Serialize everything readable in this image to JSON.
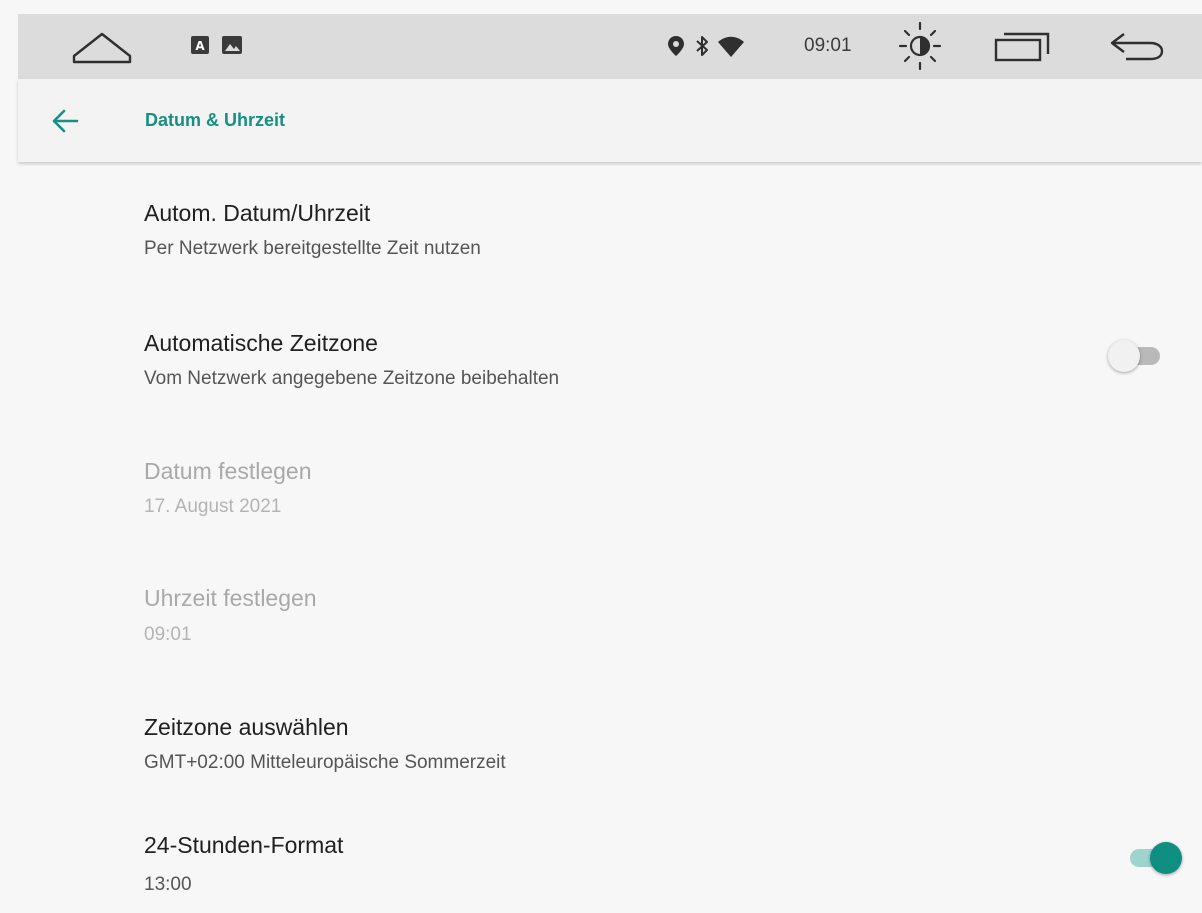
{
  "status_bar": {
    "time": "09:01",
    "icons": [
      "home-icon",
      "notification-a-icon",
      "notification-image-icon",
      "location-icon",
      "bluetooth-icon",
      "wifi-icon",
      "brightness-icon",
      "recents-icon",
      "back-icon"
    ]
  },
  "app_bar": {
    "title": "Datum & Uhrzeit",
    "back_icon": "arrow-left-icon",
    "accent_color": "#178f83"
  },
  "settings": [
    {
      "title": "Autom. Datum/Uhrzeit",
      "summary": "Per Netzwerk bereitgestellte Zeit nutzen",
      "enabled": true
    },
    {
      "title": "Automatische Zeitzone",
      "summary": "Vom Netzwerk angegebene Zeitzone beibehalten",
      "enabled": true,
      "switch_on": false
    },
    {
      "title": "Datum festlegen",
      "summary": "17. August 2021",
      "enabled": false
    },
    {
      "title": "Uhrzeit festlegen",
      "summary": "09:01",
      "enabled": false
    },
    {
      "title": "Zeitzone auswählen",
      "summary": "GMT+02:00 Mitteleuropäische Sommerzeit",
      "enabled": true
    },
    {
      "title": "24-Stunden-Format",
      "summary": "13:00",
      "enabled": true,
      "switch_on": true
    }
  ]
}
